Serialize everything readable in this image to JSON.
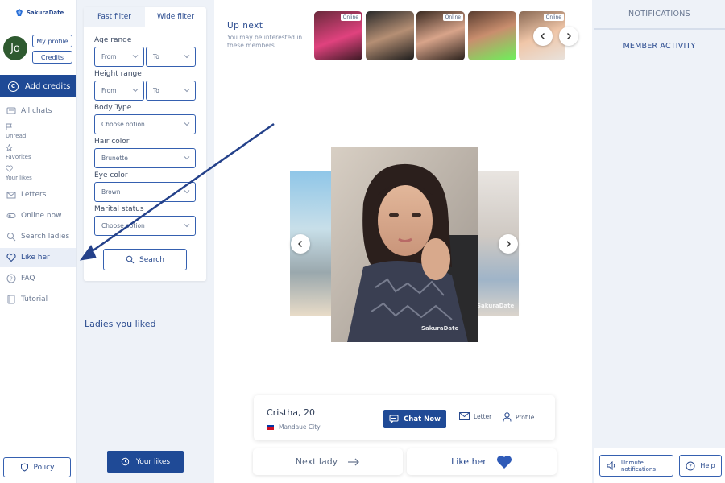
{
  "brand": {
    "name": "SakuraDate"
  },
  "user": {
    "initials": "Jo",
    "my_profile": "My profile",
    "credits": "Credits",
    "add_credits": "Add credits"
  },
  "nav": {
    "all_chats": "All chats",
    "unread": "Unread",
    "favorites": "Favorites",
    "your_likes": "Your likes",
    "letters": "Letters",
    "online_now": "Online now",
    "search_ladies": "Search ladies",
    "like_her": "Like her",
    "faq": "FAQ",
    "tutorial": "Tutorial",
    "policy": "Policy"
  },
  "filter": {
    "tab_fast": "Fast filter",
    "tab_wide": "Wide filter",
    "age_label": "Age range",
    "height_label": "Height range",
    "from": "From",
    "to": "To",
    "body_label": "Body Type",
    "body_value": "Choose option",
    "hair_label": "Hair color",
    "hair_value": "Brunette",
    "eye_label": "Eye color",
    "eye_value": "Brown",
    "marital_label": "Marital status",
    "marital_value": "Choose option",
    "search": "Search"
  },
  "liked": {
    "title": "Ladies you liked",
    "your_likes_btn": "Your likes"
  },
  "upnext": {
    "title": "Up next",
    "subtitle": "You may be interested in these members",
    "online": "Online"
  },
  "profile": {
    "name_age": "Cristha, 20",
    "city": "Mandaue City",
    "chat_now": "Chat Now",
    "letter": "Letter",
    "profile": "Profile",
    "watermark": "SakuraDate"
  },
  "actions": {
    "next_lady": "Next lady",
    "like_her": "Like her"
  },
  "right": {
    "notifications": "NOTIFICATIONS",
    "activity": "MEMBER ACTIVITY",
    "unmute_1": "Unmute",
    "unmute_2": "notifications",
    "help": "Help"
  },
  "colors": {
    "primary": "#1f4a96",
    "accent_border": "#3560b0",
    "annotation_arrow": "#24418a"
  }
}
